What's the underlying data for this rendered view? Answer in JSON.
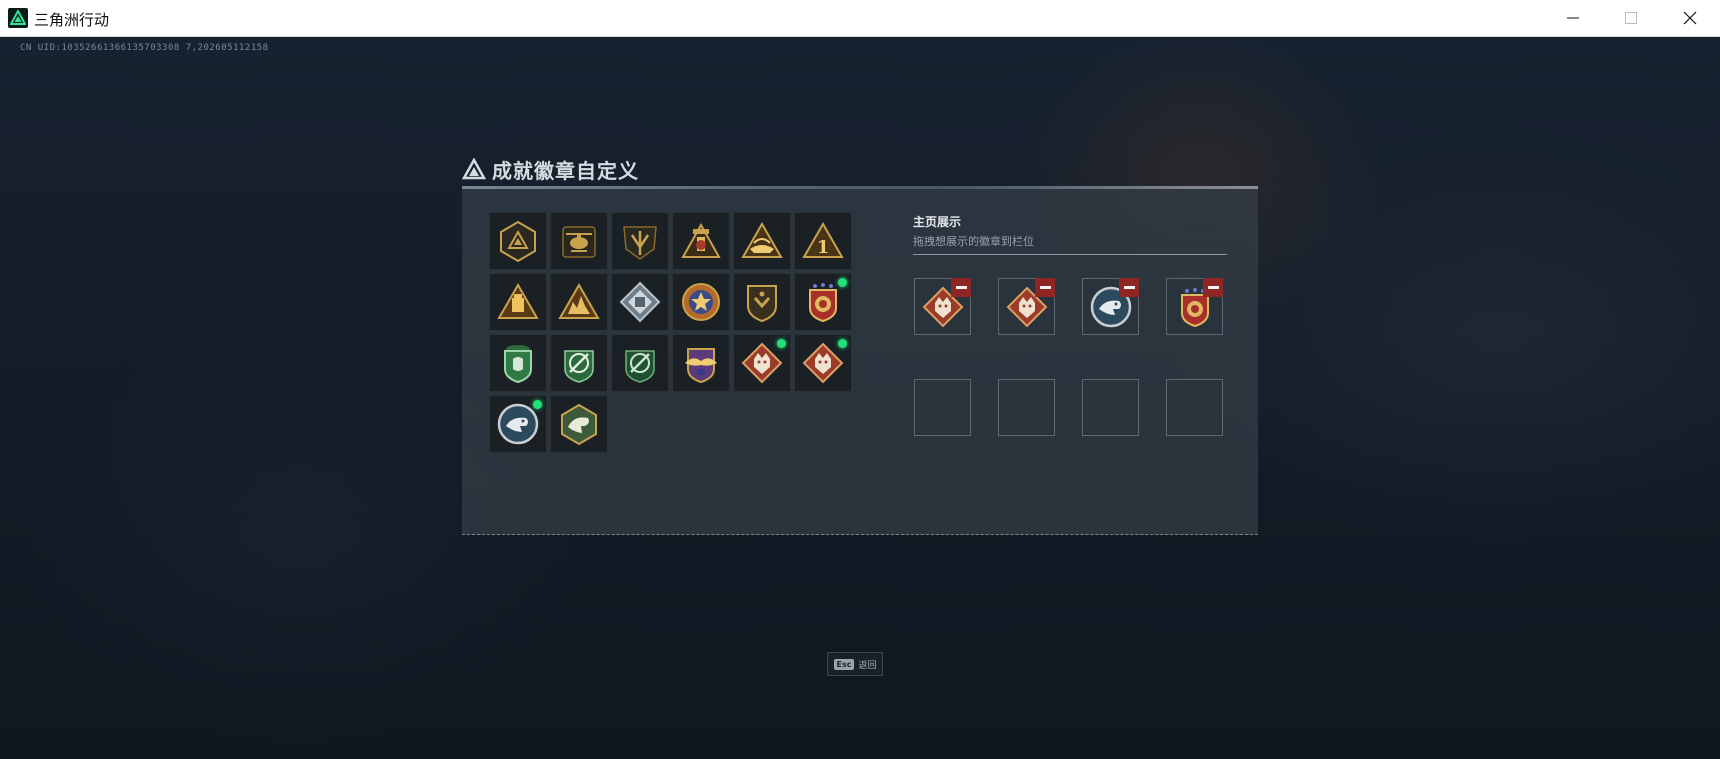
{
  "window": {
    "title": "三角洲行动",
    "controls": {
      "minimize": "minimize",
      "maximize": "maximize",
      "close": "close"
    }
  },
  "uid_text": "CN UID:10352661366135703308 7,202605112158",
  "panel": {
    "title": "成就徽章自定义",
    "showcase": {
      "title": "主页展示",
      "subtitle": "拖拽想展示的徽章到栏位"
    }
  },
  "badges": [
    {
      "icon": "hex-triangle-badge-icon",
      "owned": true,
      "new": false
    },
    {
      "icon": "helicopter-badge-icon",
      "owned": true,
      "new": false
    },
    {
      "icon": "shield-arrow-badge-icon",
      "owned": true,
      "new": false
    },
    {
      "icon": "tower-badge-icon",
      "owned": true,
      "new": false
    },
    {
      "icon": "triangle-ship-badge-icon",
      "owned": true,
      "new": false
    },
    {
      "icon": "triangle-number-one-badge-icon",
      "owned": true,
      "new": false
    },
    {
      "icon": "triangle-block-badge-icon",
      "owned": true,
      "new": false
    },
    {
      "icon": "triangle-ruins-badge-icon",
      "owned": true,
      "new": false
    },
    {
      "icon": "diamond-crate-badge-icon",
      "owned": true,
      "new": false
    },
    {
      "icon": "star-medal-badge-icon",
      "owned": true,
      "new": false
    },
    {
      "icon": "shield-chevron-badge-icon",
      "owned": true,
      "new": false
    },
    {
      "icon": "red-crest-badge-icon",
      "owned": true,
      "new": true
    },
    {
      "icon": "green-lion-shield-badge-icon",
      "owned": true,
      "new": false
    },
    {
      "icon": "green-crosshair-badge-icon",
      "owned": true,
      "new": false
    },
    {
      "icon": "green-crosshair-dark-badge-icon",
      "owned": true,
      "new": false
    },
    {
      "icon": "purple-wing-shield-badge-icon",
      "owned": true,
      "new": false
    },
    {
      "icon": "wolf-diamond-badge-icon",
      "owned": true,
      "new": true
    },
    {
      "icon": "wolf-diamond-badge-icon",
      "owned": true,
      "new": true
    },
    {
      "icon": "eagle-round-badge-icon",
      "owned": true,
      "new": true
    },
    {
      "icon": "eagle-hexagon-badge-icon",
      "owned": true,
      "new": false
    }
  ],
  "showcase_slots": [
    {
      "icon": "wolf-diamond-badge-icon",
      "filled": true
    },
    {
      "icon": "wolf-diamond-badge-icon",
      "filled": true
    },
    {
      "icon": "eagle-round-badge-icon",
      "filled": true
    },
    {
      "icon": "red-crest-badge-icon",
      "filled": true
    },
    {
      "icon": "",
      "filled": false
    },
    {
      "icon": "",
      "filled": false
    },
    {
      "icon": "",
      "filled": false
    },
    {
      "icon": "",
      "filled": false
    }
  ],
  "footer": {
    "esc_key": "Esc",
    "back_label": "返回"
  },
  "colors": {
    "gold": "#c9a24e",
    "new_dot": "#22e07a",
    "remove": "#8e2626",
    "panel_bg": "#343e46"
  }
}
